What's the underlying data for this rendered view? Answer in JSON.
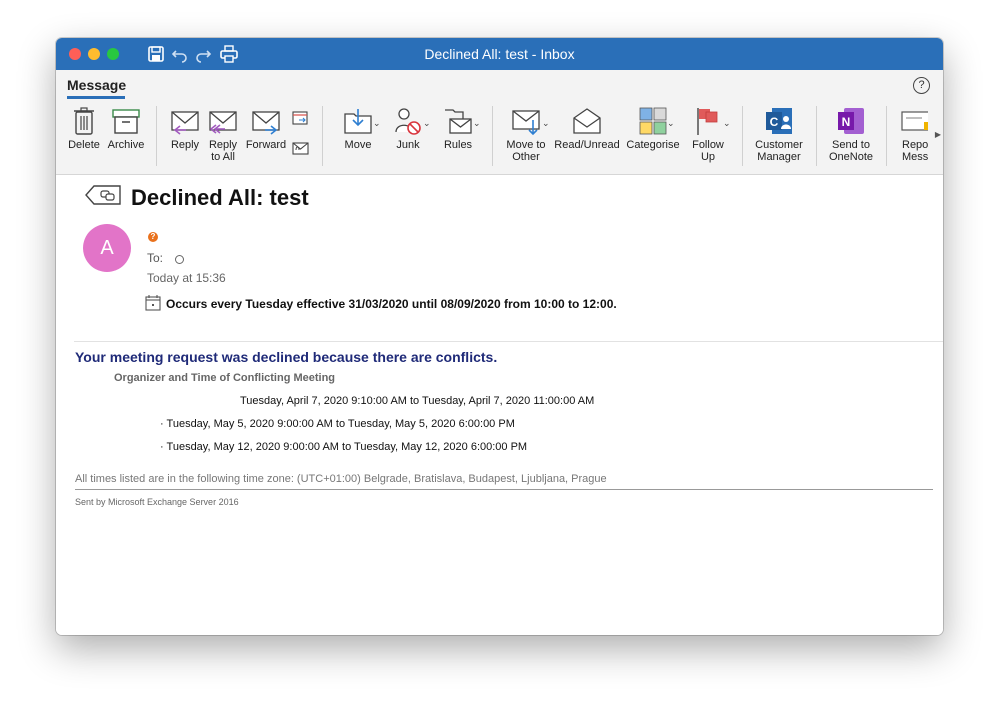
{
  "window": {
    "title": "Declined All: test - Inbox"
  },
  "ribbon_tab": "Message",
  "help_label": "?",
  "toolbar": {
    "delete": "Delete",
    "archive": "Archive",
    "reply": "Reply",
    "reply_all": "Reply\nto All",
    "forward": "Forward",
    "move": "Move",
    "junk": "Junk",
    "rules": "Rules",
    "move_to_other": "Move to\nOther",
    "read_unread": "Read/Unread",
    "categorise": "Categorise",
    "follow_up": "Follow\nUp",
    "customer_manager": "Customer\nManager",
    "send_to_onenote": "Send to\nOneNote",
    "report": "Repo\nMessa"
  },
  "message": {
    "subject": "Declined All: test",
    "avatar_initial": "A",
    "to_label": "To:",
    "received": "Today at 15:36",
    "recurrence": "Occurs every Tuesday effective 31/03/2020 until 08/09/2020 from 10:00 to 12:00."
  },
  "body": {
    "headline": "Your meeting request was declined because there are conflicts.",
    "organizer_heading": "Organizer and Time of Conflicting Meeting",
    "conflicts": [
      "Tuesday, April 7, 2020 9:10:00 AM to Tuesday, April 7, 2020 11:00:00 AM",
      "· Tuesday, May 5, 2020 9:00:00 AM to Tuesday, May 5, 2020 6:00:00 PM",
      "· Tuesday, May 12, 2020 9:00:00 AM to Tuesday, May 12, 2020 6:00:00 PM"
    ],
    "timezone_note": "All times listed are in the following time zone: (UTC+01:00) Belgrade, Bratislava, Budapest, Ljubljana, Prague",
    "sent_by": "Sent by Microsoft Exchange Server 2016"
  },
  "colors": {
    "titlebar": "#2a6fb8",
    "avatar": "#e274c8",
    "headline": "#1f2a78",
    "importance": "#e9711c"
  },
  "icons": [
    "save-icon",
    "undo-icon",
    "redo-icon",
    "print-icon",
    "trash-icon",
    "archive-box-icon",
    "reply-icon",
    "reply-all-icon",
    "forward-icon",
    "calendar-forward-icon",
    "envelope-attach-icon",
    "move-folder-icon",
    "junk-icon",
    "rules-icon",
    "move-to-other-icon",
    "read-unread-icon",
    "categorise-icon",
    "follow-up-flag-icon",
    "customer-manager-icon",
    "onenote-icon",
    "report-message-icon",
    "tag-icon",
    "calendar-icon"
  ]
}
